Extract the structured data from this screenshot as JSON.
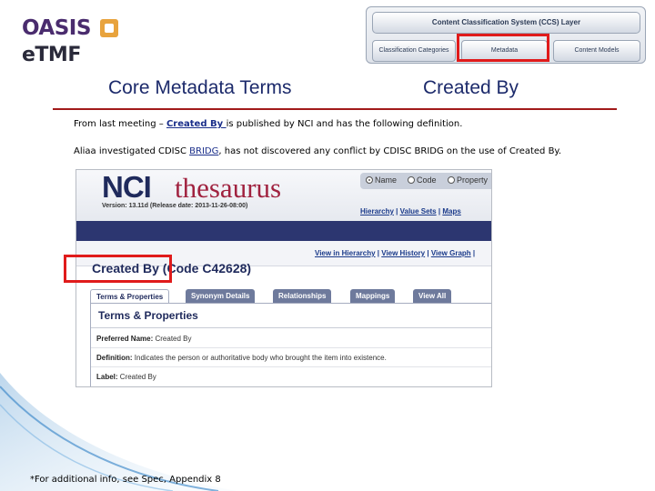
{
  "logo": {
    "line1": "OASIS",
    "line2": "eTMF"
  },
  "ccs": {
    "layer_title": "Content Classification System (CCS) Layer",
    "buttons": [
      "Classification Categories",
      "Metadata",
      "Content Models"
    ]
  },
  "headings": {
    "left": "Core Metadata Terms",
    "right": "Created By"
  },
  "body": {
    "p1_prefix": "From last meeting – ",
    "p1_link": "Created By ",
    "p1_suffix": "is published by NCI and has the following definition.",
    "p2_prefix": "Aliaa investigated CDISC ",
    "p2_link": "BRIDG",
    "p2_suffix": ", has not discovered any conflict by CDISC BRIDG on the use of Created By."
  },
  "nci": {
    "brand_nci": "NCI",
    "brand_thes": "thesaurus",
    "version": "Version: 13.11d (Release date: 2013-11-26-08:00)",
    "radio_options": [
      "Name",
      "Code",
      "Property"
    ],
    "links1": [
      "Hierarchy",
      "Value Sets",
      "Maps"
    ],
    "links2": [
      "View in Hierarchy",
      "View History",
      "View Graph"
    ],
    "title": "Created By (Code C42628)",
    "tabs": [
      "Terms & Properties",
      "Synonym Details",
      "Relationships",
      "Mappings",
      "View All"
    ],
    "panel_title": "Terms & Properties",
    "rows": [
      {
        "label": "Preferred Name:",
        "value": " Created By"
      },
      {
        "label": "Definition:",
        "value": " Indicates the person or authoritative body who brought the item into existence."
      },
      {
        "label": "Label:",
        "value": " Created By"
      }
    ]
  },
  "footnote": "*For additional info, see Spec, Appendix 8",
  "colors": {
    "heading": "#1c2a6b",
    "rule": "#a11a1a",
    "highlight": "#e01b1b",
    "nci_bar": "#2c3670"
  }
}
